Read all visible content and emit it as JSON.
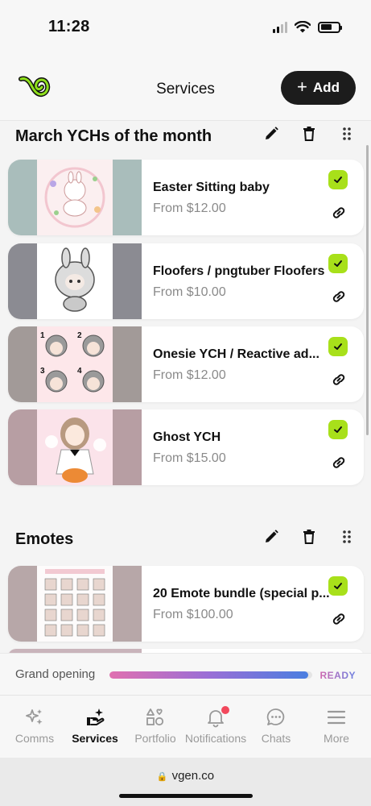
{
  "status": {
    "time": "11:28"
  },
  "header": {
    "title": "Services",
    "add_label": "Add",
    "logo_color": "#8fe01c"
  },
  "sections": [
    {
      "title": "March YCHs of the month",
      "cards": [
        {
          "title": "Easter Sitting baby",
          "price": "From $12.00",
          "thumb_bg": "#a9bdbb"
        },
        {
          "title": "Floofers / pngtuber Floofers",
          "price": "From $10.00",
          "thumb_bg": "#8b8b92"
        },
        {
          "title": "Onesie YCH / Reactive ad...",
          "price": "From $12.00",
          "thumb_bg": "#a29a98"
        },
        {
          "title": "Ghost YCH",
          "price": "From $15.00",
          "thumb_bg": "#b79ea3"
        }
      ]
    },
    {
      "title": "Emotes",
      "cards": [
        {
          "title": "20 Emote bundle (special p...",
          "price": "From $100.00",
          "thumb_bg": "#b7a7a8"
        }
      ]
    }
  ],
  "progress": {
    "label": "Grand opening",
    "status": "READY",
    "fraction": 0.98
  },
  "tabs": [
    {
      "label": "Comms",
      "icon": "sparkles-icon",
      "active": false
    },
    {
      "label": "Services",
      "icon": "services-icon",
      "active": true
    },
    {
      "label": "Portfolio",
      "icon": "shapes-icon",
      "active": false
    },
    {
      "label": "Notifications",
      "icon": "bell-icon",
      "active": false
    },
    {
      "label": "Chats",
      "icon": "chat-icon",
      "active": false
    },
    {
      "label": "More",
      "icon": "menu-icon",
      "active": false
    }
  ],
  "browser": {
    "url": "vgen.co"
  },
  "colors": {
    "accent_green": "#a8e01a",
    "dark_button": "#1c1c1c",
    "notification_dot": "#f2485c"
  }
}
